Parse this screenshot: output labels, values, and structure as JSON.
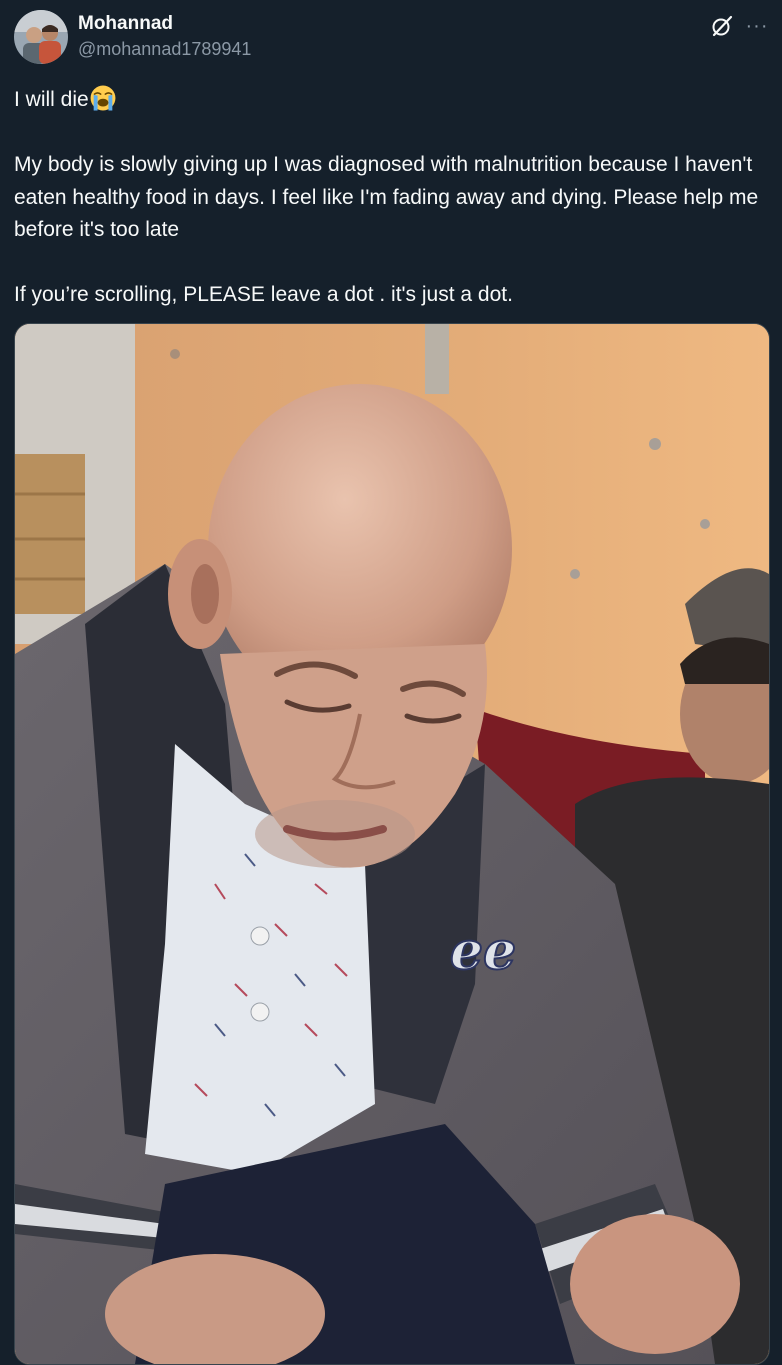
{
  "tweet": {
    "author": {
      "display_name": "Mohannad",
      "handle": "@mohannad1789941"
    },
    "actions": {
      "grok_icon": "grok-icon",
      "more_label": "···"
    },
    "text": {
      "line1": "I will die",
      "line1_emoji": "loudly-crying-face",
      "paragraph2": "My body is slowly giving up I was diagnosed with malnutrition because I haven't eaten healthy food in days. I feel like I'm fading away and dying. Please help me before it's too late",
      "paragraph3": "If you’re scrolling, PLEASE leave a dot . it's just a dot."
    },
    "media": {
      "jacket_logo_text": "ee"
    }
  },
  "colors": {
    "background": "#15202b",
    "text_primary": "#f7f9f9",
    "text_secondary": "#8b98a5",
    "border": "#38444d"
  }
}
